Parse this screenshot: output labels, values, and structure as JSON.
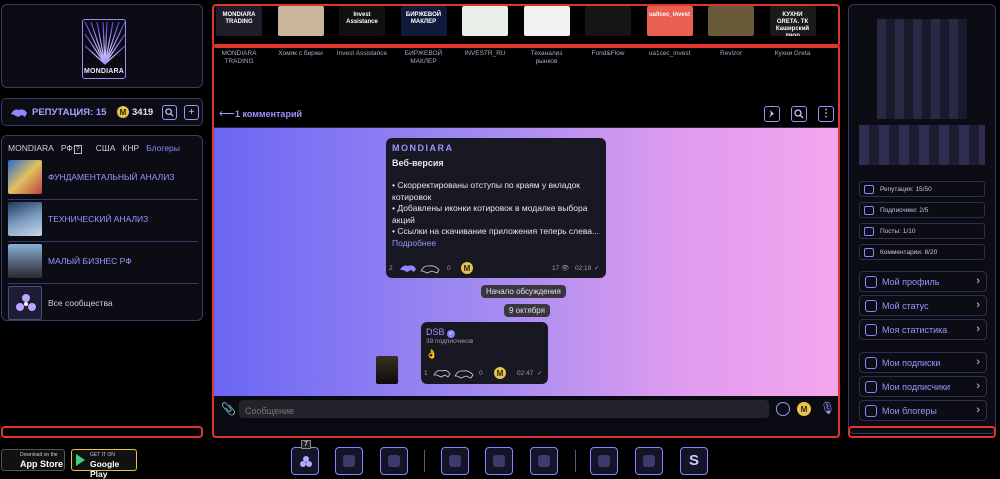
{
  "brand": {
    "name": "MONDIARA"
  },
  "reputation": {
    "label": "РЕПУТАЦИЯ: 15",
    "coin_symbol": "M",
    "coins": "3419",
    "plus_label": "+"
  },
  "community_tabs": [
    "MONDIARA",
    "РФ",
    "США",
    "КНР",
    "Блогеры"
  ],
  "community_tab_badge": "?",
  "communities": [
    {
      "label": "ФУНДАМЕНТАЛЬНЫЙ АНАЛИЗ"
    },
    {
      "label": "ТЕХНИЧЕСКИЙ АНАЛИЗ"
    },
    {
      "label": "МАЛЫЙ БИЗНЕС РФ"
    },
    {
      "label": "Все сообщества"
    }
  ],
  "top_channels": [
    {
      "label": "MONDIARA TRADING",
      "thumb_text": "MONDIARA TRADING",
      "color": "#1e1d2a"
    },
    {
      "label": "Хомяк с биржи",
      "thumb_text": "",
      "color": "#c9b59a"
    },
    {
      "label": "Invest Assistance",
      "thumb_text": "Invest Assistance",
      "color": "#111111"
    },
    {
      "label": "БИРЖЕВОЙ МАКЛЕР",
      "thumb_text": "БИРЖЕВОЙ МАКЛЕР",
      "color": "#0e1a3a"
    },
    {
      "label": "INVESTR_RU",
      "thumb_text": "",
      "color": "#e8efe8"
    },
    {
      "label": "Теханализ рынков",
      "thumb_text": "",
      "color": "#f2f2f2"
    },
    {
      "label": "Fond&Flow",
      "thumb_text": "",
      "color": "#151515"
    },
    {
      "label": "ua1cec_invest",
      "thumb_text": "uallcec_invest",
      "color": "#e86050"
    },
    {
      "label": "Revizor",
      "thumb_text": "",
      "color": "#6a5a3a"
    },
    {
      "label": "Кухни Greta",
      "thumb_text": "КУХНИ GRETA. ТК Каширский двор",
      "color": "#1a1a1a"
    }
  ],
  "chat": {
    "back_label": "1 комментарий",
    "post": {
      "channel": "MONDIARA",
      "title": "Веб-версия",
      "lines": [
        "• Скорректированы отступы по краям у вкладок котировок",
        "• Добавлены иконки котировок в модалке выбора акций",
        "• Ссылки на скачивание приложения теперь слева..."
      ],
      "more": "Подробнее",
      "left_count": "2",
      "mid_count": "0",
      "views": "17",
      "time": "02:19"
    },
    "discussion_label": "Начало обсуждения",
    "date_label": "9 октября",
    "reply": {
      "author": "DSB",
      "subscribers": "39 подписчиков",
      "text": "👌",
      "left_count": "1",
      "mid_count": "0",
      "time": "02:47"
    },
    "composer_placeholder": "Сообщение"
  },
  "stats": [
    {
      "label": "Репутация: 15/50"
    },
    {
      "label": "Подписчики: 2/5"
    },
    {
      "label": "Посты: 1/10"
    },
    {
      "label": "Комментарии: 8/20"
    }
  ],
  "profile_menu": [
    {
      "label": "Мой профиль"
    },
    {
      "label": "Мой статус"
    },
    {
      "label": "Моя статистика"
    }
  ],
  "social_menu": [
    {
      "label": "Мои подписки"
    },
    {
      "label": "Мои подписчики"
    },
    {
      "label": "Мои блогеры"
    }
  ],
  "stores": {
    "apple_small": "Download on the",
    "apple": "App Store",
    "google_small": "GET IT ON",
    "google": "Google Play"
  },
  "bottom_badge": "7",
  "bottom_s": "S",
  "colors": {
    "accent": "#8a84ff",
    "highlight": "#e0352b",
    "coin": "#e8c34a"
  }
}
